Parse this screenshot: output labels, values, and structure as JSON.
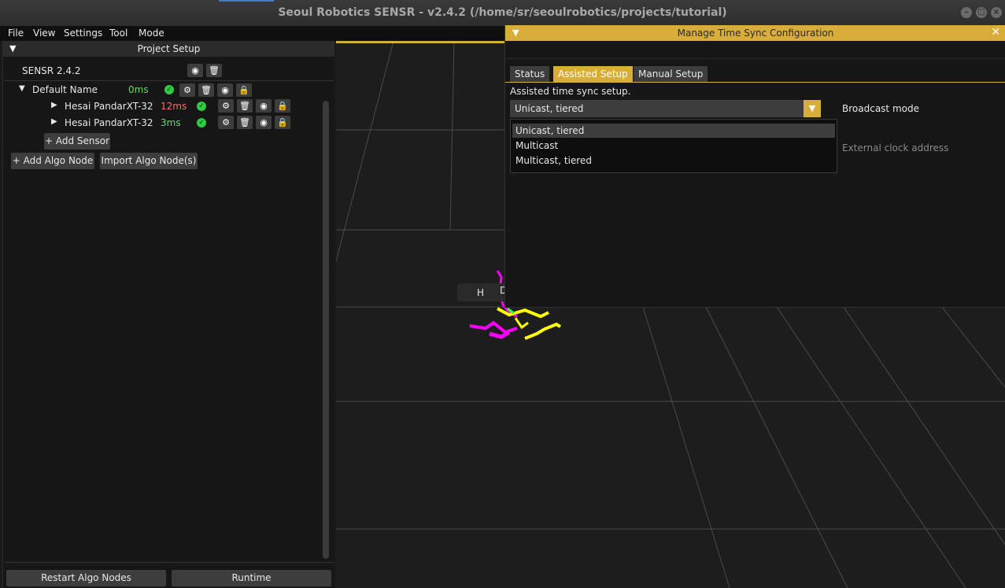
{
  "window": {
    "title": "Seoul Robotics SENSR - v2.4.2 (/home/sr/seoulrobotics/projects/tutorial)"
  },
  "menu": [
    "File",
    "View",
    "Settings",
    "Tool",
    "Mode"
  ],
  "project_setup": {
    "header": "Project Setup",
    "version_label": "SENSR 2.4.2",
    "group": {
      "name": "Default Name",
      "latency": "0ms"
    },
    "sensors": [
      {
        "name": "Hesai PandarXT-32",
        "latency": "12ms",
        "latency_color": "#ff6b6b"
      },
      {
        "name": "Hesai PandarXT-32",
        "latency": "3ms",
        "latency_color": "#5ee05e"
      }
    ],
    "add_sensor": "+ Add Sensor",
    "add_algo_node": "+ Add Algo Node",
    "import_algo_nodes": "Import Algo Node(s)",
    "restart_algo_nodes": "Restart Algo Nodes",
    "runtime": "Runtime"
  },
  "time_sync": {
    "title": "Manage Time Sync Configuration",
    "tabs": [
      "Status",
      "Assisted Setup",
      "Manual Setup"
    ],
    "active_tab": "Assisted Setup",
    "description": "Assisted time sync setup.",
    "mode_value": "Unicast, tiered",
    "mode_label": "Broadcast mode",
    "options": [
      "Unicast, tiered",
      "Multicast",
      "Multicast, tiered"
    ],
    "external_clock_label": "External clock address"
  },
  "viewport": {
    "tooltip_fragment_1": "H",
    "tooltip_fragment_2": "D"
  },
  "colors": {
    "accent": "#d9ad3a",
    "ok": "#2ecc40"
  }
}
